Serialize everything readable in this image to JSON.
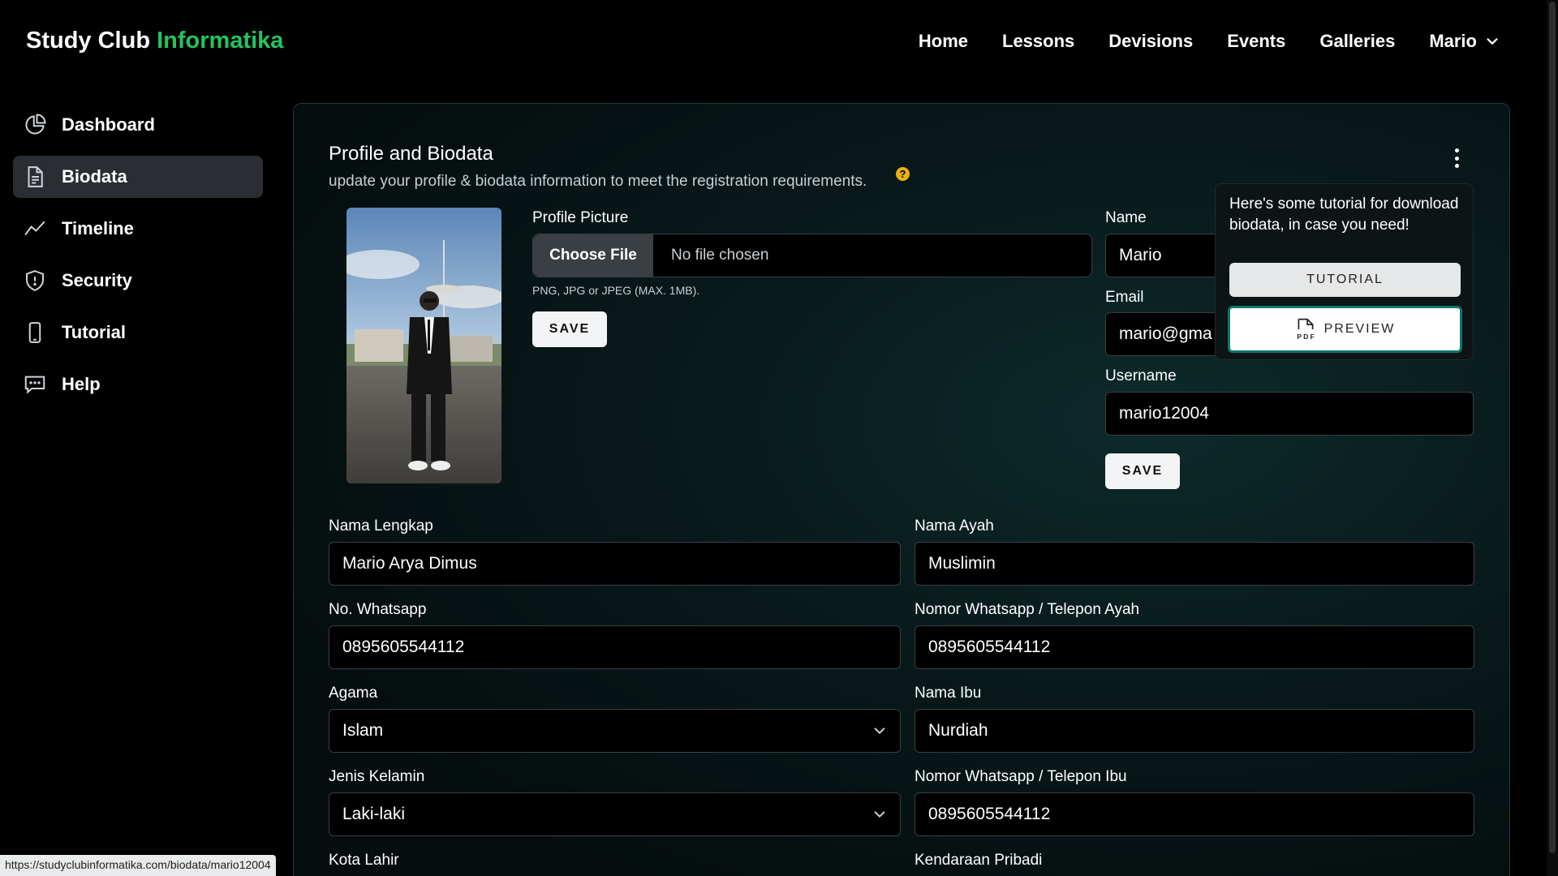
{
  "header": {
    "brand_main": "Study Club",
    "brand_accent": "Informatika",
    "nav": [
      "Home",
      "Lessons",
      "Devisions",
      "Events",
      "Galleries"
    ],
    "user": "Mario"
  },
  "sidebar": {
    "items": [
      {
        "label": "Dashboard",
        "icon": "pie-chart-icon"
      },
      {
        "label": "Biodata",
        "icon": "document-icon"
      },
      {
        "label": "Timeline",
        "icon": "trend-icon"
      },
      {
        "label": "Security",
        "icon": "shield-icon"
      },
      {
        "label": "Tutorial",
        "icon": "phone-icon"
      },
      {
        "label": "Help",
        "icon": "chat-icon"
      }
    ],
    "active": "Biodata"
  },
  "profile": {
    "title": "Profile and Biodata",
    "subtitle": "update your profile & biodata information to meet the registration requirements.",
    "help_badge": "?",
    "picture_label": "Profile Picture",
    "choose_file": "Choose File",
    "no_file": "No file chosen",
    "file_hint": "PNG, JPG or JPEG (MAX. 1MB).",
    "save_picture": "SAVE",
    "name_label": "Name",
    "name_value": "Mario",
    "email_label": "Email",
    "email_value": "mario@gma",
    "username_label": "Username",
    "username_value": "mario12004",
    "save_account": "SAVE"
  },
  "popover": {
    "text": "Here's some tutorial for download biodata, in case you need!",
    "tutorial_button": "TUTORIAL",
    "preview_button": "PREVIEW",
    "pdf_tag": "PDF"
  },
  "biodata": {
    "nama_lengkap_label": "Nama Lengkap",
    "nama_lengkap": "Mario Arya Dimus",
    "nama_ayah_label": "Nama Ayah",
    "nama_ayah": "Muslimin",
    "whatsapp_label": "No. Whatsapp",
    "whatsapp": "0895605544112",
    "whatsapp_ayah_label": "Nomor Whatsapp / Telepon Ayah",
    "whatsapp_ayah": "0895605544112",
    "agama_label": "Agama",
    "agama": "Islam",
    "nama_ibu_label": "Nama Ibu",
    "nama_ibu": "Nurdiah",
    "jenis_kelamin_label": "Jenis Kelamin",
    "jenis_kelamin": "Laki-laki",
    "whatsapp_ibu_label": "Nomor Whatsapp / Telepon Ibu",
    "whatsapp_ibu": "0895605544112",
    "kota_lahir_label": "Kota Lahir",
    "kendaraan_label": "Kendaraan Pribadi"
  },
  "status_bar": {
    "url": "https://studyclubinformatika.com/biodata/mario12004"
  },
  "colors": {
    "accent": "#22c55e",
    "help_badge": "#eab308",
    "preview_border": "#0f766e"
  }
}
